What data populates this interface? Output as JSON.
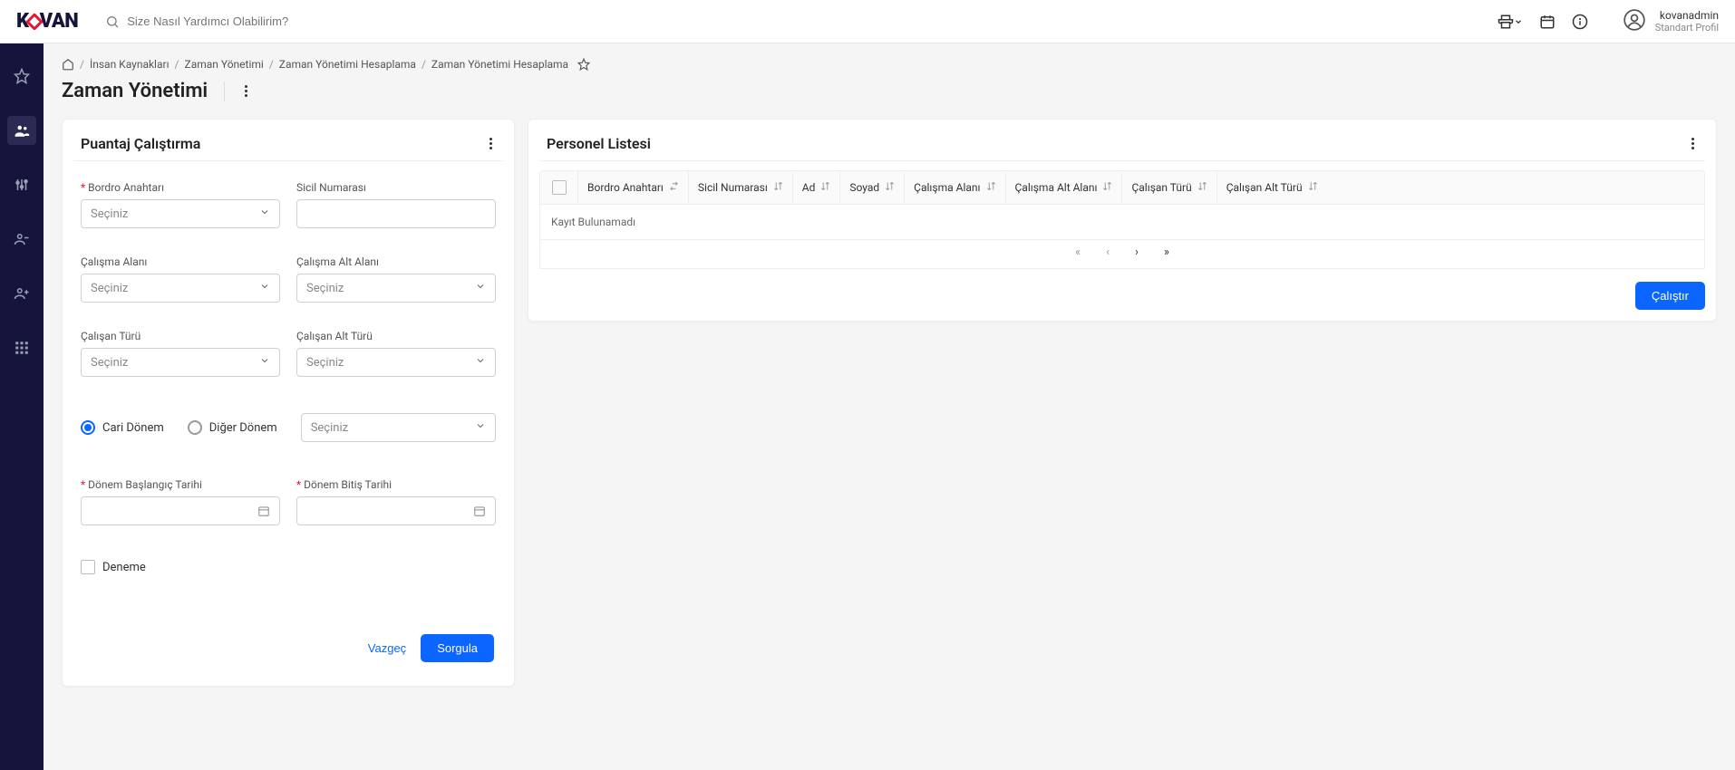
{
  "search": {
    "placeholder": "Size Nasıl Yardımcı Olabilirim?"
  },
  "user": {
    "name": "kovanadmin",
    "role": "Standart Profil"
  },
  "breadcrumb": {
    "items": [
      "İnsan Kaynakları",
      "Zaman Yönetimi",
      "Zaman Yönetimi Hesaplama",
      "Zaman Yönetimi Hesaplama"
    ]
  },
  "page": {
    "title": "Zaman Yönetimi"
  },
  "leftCard": {
    "title": "Puantaj Çalıştırma",
    "fields": {
      "bordro_anahtari": {
        "label": "Bordro Anahtarı",
        "placeholder": "Seçiniz"
      },
      "sicil_numarasi": {
        "label": "Sicil Numarası"
      },
      "calisma_alani": {
        "label": "Çalışma Alanı",
        "placeholder": "Seçiniz"
      },
      "calisma_alt_alani": {
        "label": "Çalışma Alt Alanı",
        "placeholder": "Seçiniz"
      },
      "calisan_turu": {
        "label": "Çalışan Türü",
        "placeholder": "Seçiniz"
      },
      "calisan_alt_turu": {
        "label": "Çalışan Alt Türü",
        "placeholder": "Seçiniz"
      },
      "period_select": {
        "placeholder": "Seçiniz"
      },
      "donem_baslangic": {
        "label": "Dönem Başlangıç Tarihi"
      },
      "donem_bitis": {
        "label": "Dönem Bitiş Tarihi"
      },
      "deneme": {
        "label": "Deneme"
      }
    },
    "radios": {
      "cari": "Cari Dönem",
      "diger": "Diğer Dönem"
    },
    "actions": {
      "cancel": "Vazgeç",
      "query": "Sorgula"
    }
  },
  "rightCard": {
    "title": "Personel Listesi",
    "columns": [
      "Bordro Anahtarı",
      "Sicil Numarası",
      "Ad",
      "Soyad",
      "Çalışma Alanı",
      "Çalışma Alt Alanı",
      "Çalışan Türü",
      "Çalışan Alt Türü"
    ],
    "empty": "Kayıt Bulunamadı",
    "action": "Çalıştır"
  }
}
